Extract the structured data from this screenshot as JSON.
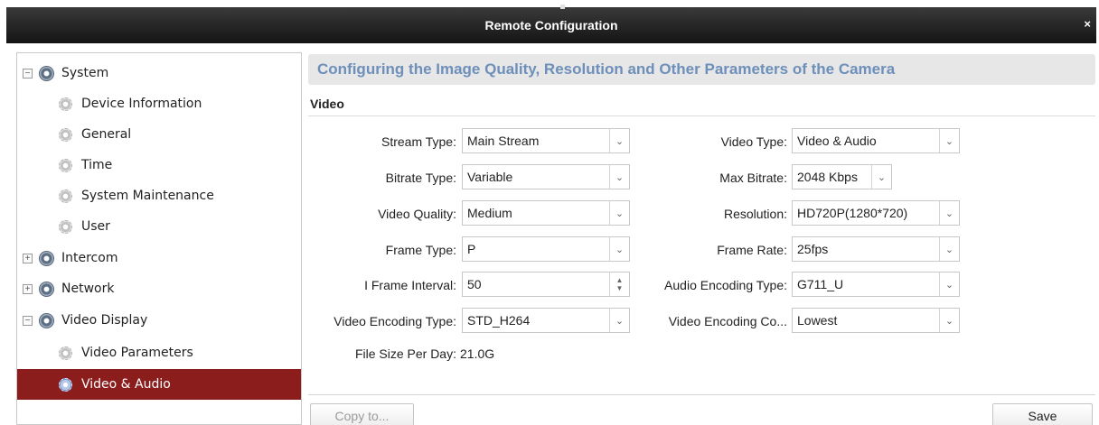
{
  "window": {
    "title": "Remote Configuration",
    "close_glyph": "×"
  },
  "sidebar": {
    "items": [
      {
        "label": "System",
        "expander": "−"
      },
      {
        "label": "Device Information"
      },
      {
        "label": "General"
      },
      {
        "label": "Time"
      },
      {
        "label": "System Maintenance"
      },
      {
        "label": "User"
      },
      {
        "label": "Intercom",
        "expander": "+"
      },
      {
        "label": "Network",
        "expander": "+"
      },
      {
        "label": "Video Display",
        "expander": "−"
      },
      {
        "label": "Video Parameters"
      },
      {
        "label": "Video & Audio",
        "selected": true
      }
    ]
  },
  "main": {
    "header": "Configuring the Image Quality, Resolution and Other Parameters of the Camera",
    "section": "Video",
    "left_fields": [
      {
        "label": "Stream Type:",
        "value": "Main Stream"
      },
      {
        "label": "Bitrate Type:",
        "value": "Variable"
      },
      {
        "label": "Video Quality:",
        "value": "Medium"
      },
      {
        "label": "Frame Type:",
        "value": "P"
      },
      {
        "label": "I Frame Interval:",
        "value": "50"
      },
      {
        "label": "Video Encoding Type:",
        "value": "STD_H264"
      }
    ],
    "right_fields": [
      {
        "label": "Video Type:",
        "value": "Video & Audio"
      },
      {
        "label": "Max Bitrate:",
        "value": "2048 Kbps"
      },
      {
        "label": "Resolution:",
        "value": "HD720P(1280*720)"
      },
      {
        "label": "Frame Rate:",
        "value": "25fps"
      },
      {
        "label": "Audio Encoding Type:",
        "value": "G711_U"
      },
      {
        "label": "Video Encoding Co...",
        "value": "Lowest"
      }
    ],
    "file_size": {
      "label": "File Size Per Day:",
      "value": "21.0G"
    },
    "copy_button": "Copy to...",
    "save_button": "Save"
  },
  "icons": {
    "dropdown": "chevron-down-icon",
    "spinner": "spinner-arrows-icon",
    "tree_node": "camera-icon",
    "tree_leaf": "gear-icon"
  },
  "colors": {
    "selected_row": "#8b1d1d",
    "header_text": "#6d8fba"
  }
}
